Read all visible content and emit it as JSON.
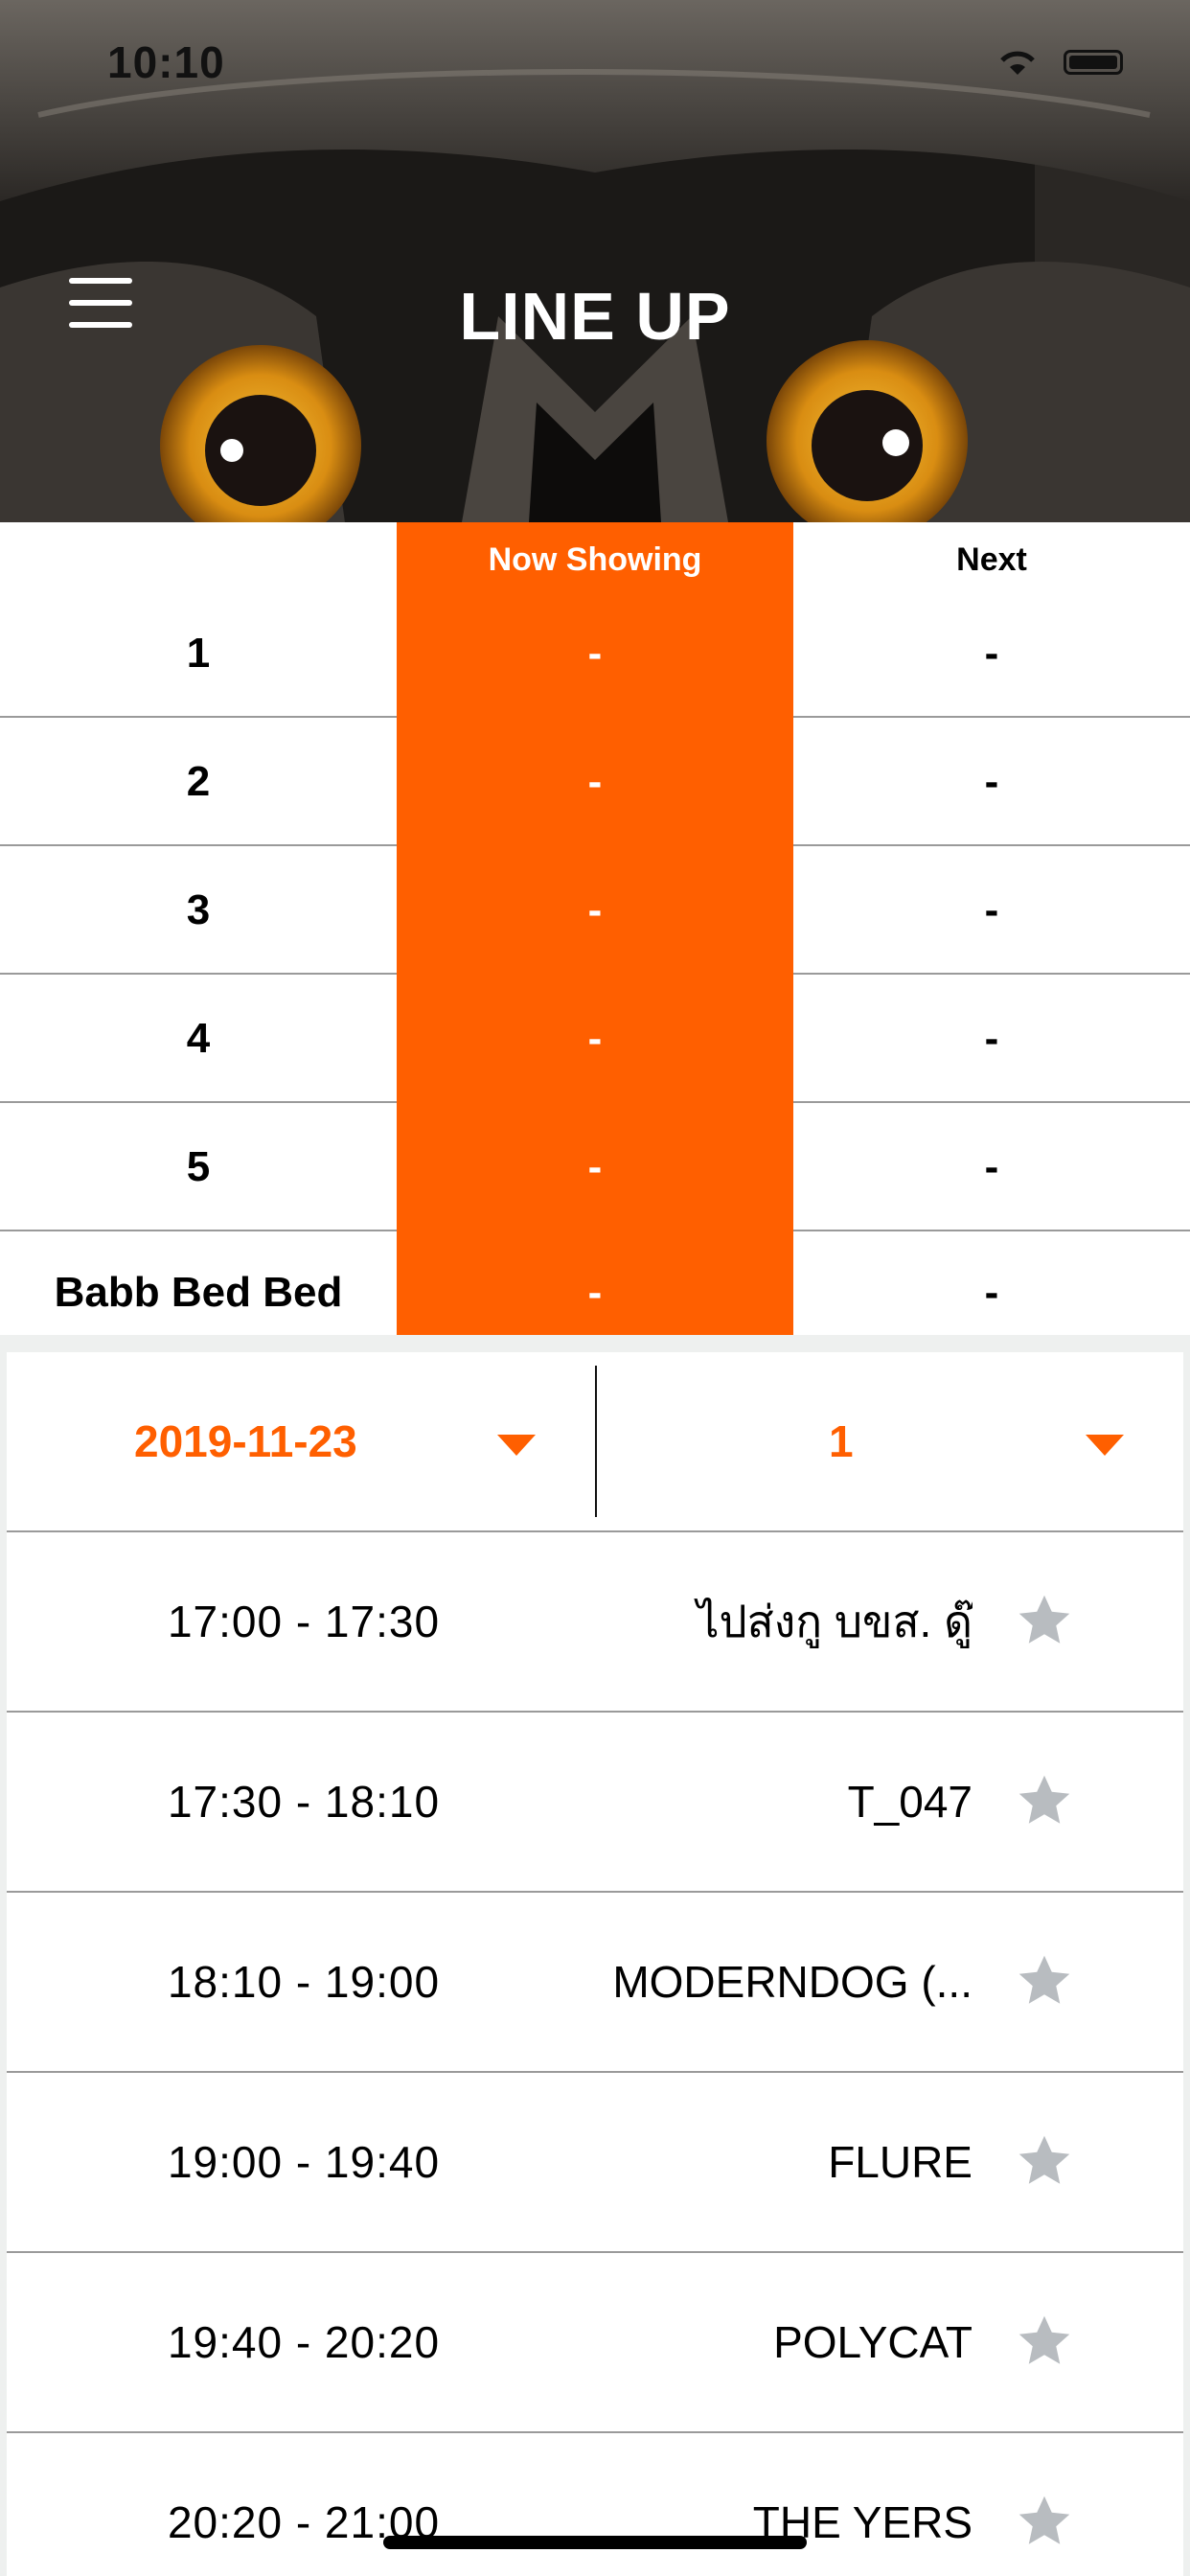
{
  "status_bar": {
    "time": "10:10"
  },
  "header": {
    "title": "LINE UP"
  },
  "stage_table": {
    "columns": [
      "Now Showing",
      "Next"
    ],
    "rows": [
      {
        "stage": "1",
        "now": "-",
        "next": "-"
      },
      {
        "stage": "2",
        "now": "-",
        "next": "-"
      },
      {
        "stage": "3",
        "now": "-",
        "next": "-"
      },
      {
        "stage": "4",
        "now": "-",
        "next": "-"
      },
      {
        "stage": "5",
        "now": "-",
        "next": "-"
      },
      {
        "stage": "Babb Bed Bed",
        "now": "-",
        "next": "-"
      }
    ]
  },
  "filters": {
    "date": "2019-11-23",
    "stage": "1"
  },
  "schedule": [
    {
      "time": "17:00 - 17:30",
      "artist": "ไปส่งกู บขส. ดู๊"
    },
    {
      "time": "17:30 - 18:10",
      "artist": "T_047"
    },
    {
      "time": "18:10 - 19:00",
      "artist": "MODERNDOG (..."
    },
    {
      "time": "19:00 - 19:40",
      "artist": "FLURE"
    },
    {
      "time": "19:40 - 20:20",
      "artist": "POLYCAT"
    },
    {
      "time": "20:20 - 21:00",
      "artist": "THE YERS"
    }
  ],
  "colors": {
    "accent": "#ff5f00",
    "star_inactive": "#b8bcc0",
    "divider": "#9a9a9a"
  },
  "icons": {
    "menu": "hamburger-menu-icon",
    "caret": "triangle-down-icon",
    "favorite": "star-icon"
  }
}
